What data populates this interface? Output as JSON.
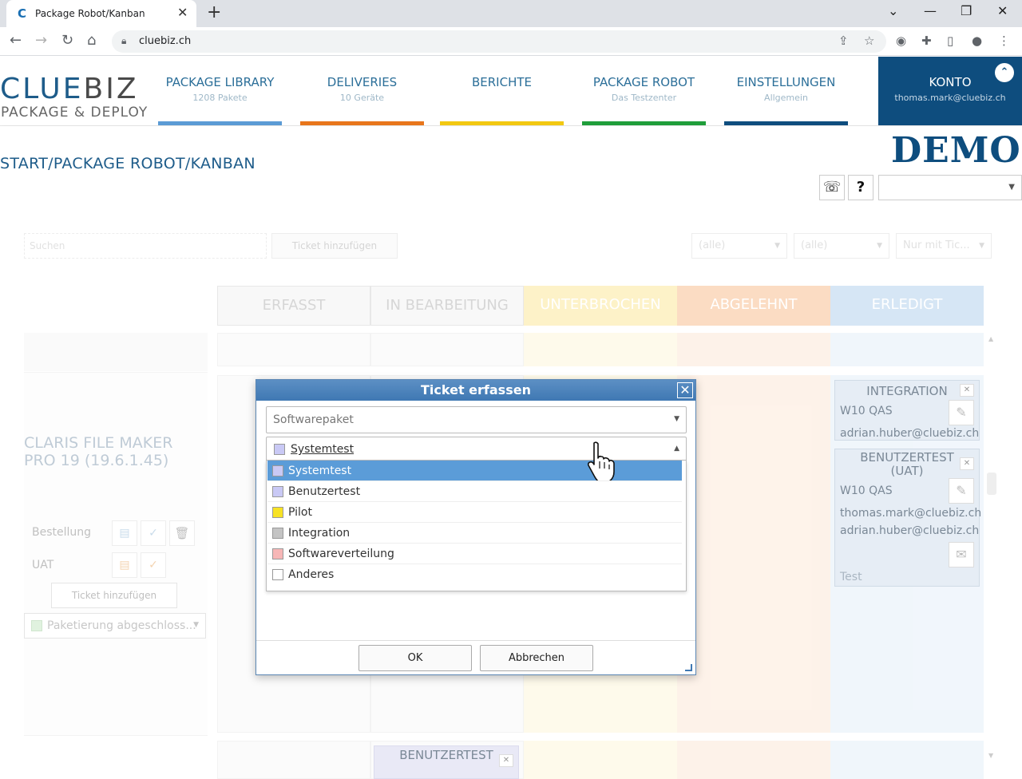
{
  "browser": {
    "tab_title": "Package Robot/Kanban",
    "url": "cluebiz.ch"
  },
  "header": {
    "logo_top_a": "CLUE",
    "logo_top_b": "BIZ",
    "logo_bottom": "PACKAGE & DEPLOY",
    "nav": [
      {
        "label": "PACKAGE LIBRARY",
        "sub": "1208 Pakete",
        "color": "#5b9bd5"
      },
      {
        "label": "DELIVERIES",
        "sub": "10 Geräte",
        "color": "#e8761b"
      },
      {
        "label": "BERICHTE",
        "sub": "",
        "color": "#f2c811"
      },
      {
        "label": "PACKAGE ROBOT",
        "sub": "Das Testzenter",
        "color": "#1f9e3a"
      },
      {
        "label": "EINSTELLUNGEN",
        "sub": "Allgemein",
        "color": "#0e4d7e"
      }
    ],
    "konto": {
      "label": "KONTO",
      "sub": "thomas.mark@cluebiz.ch"
    }
  },
  "breadcrumb": "START/PACKAGE ROBOT/KANBAN",
  "demo_label": "DEMO",
  "filters": {
    "search_placeholder": "Suchen",
    "add_ticket": "Ticket hinzufügen",
    "filter1": "(alle)",
    "filter2": "(alle)",
    "filter3": "Nur mit Tic..."
  },
  "columns": [
    {
      "label": "ERFASST",
      "bg": "#f6f6f6",
      "fg": "#c9c9c9"
    },
    {
      "label": "IN BEARBEITUNG",
      "bg": "#f6f6f6",
      "fg": "#c9c9c9"
    },
    {
      "label": "UNTERBROCHEN",
      "bg": "#fdf2c8",
      "fg": "#fff"
    },
    {
      "label": "ABGELEHNT",
      "bg": "#fbdcc3",
      "fg": "#fff"
    },
    {
      "label": "ERLEDIGT",
      "bg": "#d6e6f5",
      "fg": "#fff"
    }
  ],
  "left_panel": {
    "package_name": "CLARIS FILE MAKER PRO 19 (19.6.1.45)",
    "bestellung": "Bestellung",
    "uat": "UAT",
    "add_ticket": "Ticket hinzufügen",
    "status": "Paketierung abgeschloss..."
  },
  "cards": [
    {
      "title": "INTEGRATION",
      "env": "W10 QAS",
      "user1": "adrian.huber@cluebiz.ch"
    },
    {
      "title": "BENUTZERTEST (UAT)",
      "env": "W10 QAS",
      "user1": "thomas.mark@cluebiz.ch",
      "user2": "adrian.huber@cluebiz.ch",
      "note": "Test"
    },
    {
      "title": "BENUTZERTEST"
    }
  ],
  "modal": {
    "title": "Ticket erfassen",
    "package_placeholder": "Softwarepaket",
    "selected_type": "Systemtest",
    "options": [
      {
        "label": "Systemtest",
        "color": "#c9c9f5",
        "selected": true
      },
      {
        "label": "Benutzertest",
        "color": "#c9c9f5",
        "selected": false
      },
      {
        "label": "Pilot",
        "color": "#f7e224",
        "selected": false
      },
      {
        "label": "Integration",
        "color": "#c4c4c4",
        "selected": false
      },
      {
        "label": "Softwareverteilung",
        "color": "#f7b7b7",
        "selected": false
      },
      {
        "label": "Anderes",
        "color": "#ffffff",
        "selected": false
      }
    ],
    "ok": "OK",
    "cancel": "Abbrechen"
  }
}
